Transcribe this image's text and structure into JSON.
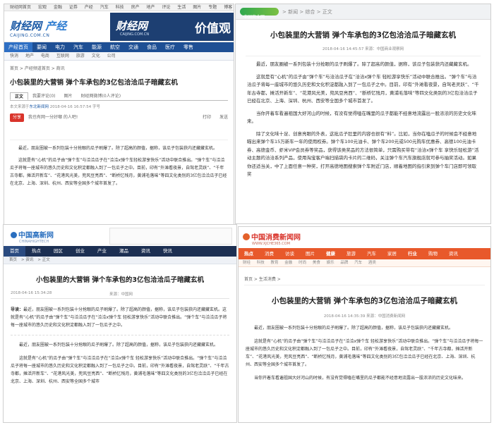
{
  "panel1": {
    "topbar_items": [
      "财经网首页",
      "宏观",
      "金融",
      "证券",
      "产经",
      "汽车",
      "科技",
      "房产",
      "地产",
      "评论",
      "生活",
      "图片",
      "专题",
      "博客",
      "视频"
    ],
    "logo_main": "财经网",
    "logo_sub": "产经",
    "logo_domain": "CAIJING.COM.CN",
    "banner_left": "财经网",
    "banner_domain": "CAIJING.COM.CN",
    "banner_right": "价值观",
    "nav_items": [
      "产经首页",
      "要闻",
      "电力",
      "汽车",
      "能源",
      "航空",
      "交通",
      "食品",
      "医疗",
      "零售"
    ],
    "subnav_items": [
      "快消",
      "地产",
      "电商",
      "互联网",
      "旅游",
      "文化",
      "公司"
    ],
    "breadcrumb": "首页 > 产经频道首页 > 商讯",
    "title": "小包装里的大营销 弹个车承包的3亿包洽洽瓜子暗藏玄机",
    "tabs": [
      "正文",
      "我要评论(0)",
      "图片",
      "财经网微博(0人评论)"
    ],
    "meta_prefix": "本文来源于",
    "meta_source": "东北新闻网",
    "meta_rest": "2018-04-16 16:57:54  字号",
    "share_button": "分享",
    "share_text": "我也有网一分好嘲 的人吧!",
    "tools": [
      "打印",
      "发送"
    ],
    "paragraphs": [
      "最近，朋友圈被一系列包装十分抢眼的瓜子刷爆了。除了超高的颜值，据称，该瓜子包装获内还藏藏玄机。",
      "这就是有“心机”的瓜子由“弹个车”与洽洽瓜子在“洽洽x弹个车轻松游享快乐”活动中联合推出。“弹个车”与洽洽瓜子将每一座城市的悠久历史和文化积淀都融入到了一包瓜子之中。目前，印有“外滩看夜景，自驾老灵跃”、“千年古寺都，摊活开新车”、“花港风光美，兜风豆亮西”、“断桥忆残月，黄浦毛落味”等四文化类别的3亿包洽洽瓜子已经在北京、上海、深圳、杭州、西安等全国多个城市首发了。"
    ]
  },
  "panel2": {
    "logo": "中国商业网",
    "breadcrumb": "> 新闻 > 综合 > 正文",
    "title": "小包装里的大营销 弹个车承包的3亿包洽洽瓜子暗藏玄机",
    "meta": "2018-04-16 14:45:57    来源：中国商业观察网",
    "paragraphs": [
      "最近，朋友圈被一系列包装十分抢眼的瓜子刷爆了。除了超高的颜值，据称，该瓜子包装获内还藏藏玄机。",
      "这就是有“心机”的瓜子由“弹个车”与洽洽瓜子在“洽洽x弹个车 轻松游享快乐”活动中联合推出。“弹个车”与洽洽瓜子将每一座城市的悠久历史和文化积淀都融入到了一包瓜子之中。目前，印有“外滩看夜景，自驾老灵跃”、“千年古寺都，摊活开新车”、“花港风光美，兜风豆亮西”、“断桥忆残月，黄浦毛落味”等四文化类别的3亿包洽洽瓜子已经在北京、上海、深圳、杭州、西安等全国多个城市首发了。",
      "当你开着车看遍祖国大好河山的时候，有没有觉得嗑在嘴里的瓜子都能不经意地流露出一股浓浓的历史文化味来。",
      "除了文化味十足、创意亮眼的外表，这批瓜子肚里的内容也很有“料”。比如，当你在嗑瓜子的时候会不经意地瞄出来弹个车15万新车一年的使用权券。弹个车100元油卡、弹个车200元或500元购车优惠券、高德100元油卡券、高德金币、虾米VIP会员券等奖品，获得该类奖品的方法很简单，只需购买带有“洽洽x弹个车 享快乐轻松游”活动主题的洽洽系列产品，使用淘宝客户端扫描袋内卡片的二维码，关注弹个车汽车旗舰店就可参与抽奖活动。如果你还适当关，中了上面任意一种奖，打开高德地图搜索弹个车附近门店，顺着地图的指引来到弹个车门店即可领取奖"
    ]
  },
  "panel3": {
    "logo_main": "中国高新网",
    "logo_sub": "CHINAHIGHTECH",
    "nav_items": [
      "首页",
      "热点",
      "园区",
      "创业",
      "产业",
      "潮品",
      "资讯",
      "快讯"
    ],
    "subnav_items": [
      "首页",
      "资讯",
      "正文"
    ],
    "title": "小包装里的大营销 弹个车承包的3亿包洽洽瓜子暗藏玄机",
    "meta_date": "2018-04-16 15:34:28",
    "meta_source": "来源：中国网",
    "digest_label": "导读：",
    "digest_text": "最近，朋友圈被一系列包装十分抢眼的瓜子刷爆了。除了超高的颜值，据称，该瓜子包装获内还藏藏玄机。这就是有“心机”的瓜子由“弹个车”与洽洽瓜子在“洽洽x弹个车 轻松游享快乐”活动中联合推出。“弹个车”与洽洽瓜子将每一座城市的悠久历史和文化积淀都融入到了一包瓜子之中。",
    "paragraphs": [
      "最近，朋友圈被一系列包装十分抢眼的瓜子刷爆了。除了超高的颜值，据称，该瓜子包装获内还藏藏玄机。",
      "这就是有“心机”的瓜子由“弹个车”与洽洽瓜子在“洽洽x弹个车 轻松游享快乐”活动中联合推出。“弹个车”与洽洽瓜子将每一座城市的悠久历史和文化积淀都融入到了一包瓜子之中。目前，印有“外滩看夜景，自驾老灵跃”、“千年古寺都，摊活开新车”、“花港风光美，兜风豆亮西”、“断桥忆残月，黄浦毛落味”等四文化类别的3亿包洽洽瓜子已经在北京、上海、深圳、杭州、西安等全国多个城市"
    ]
  },
  "panel4": {
    "logo_main": "中国消费新闻网",
    "logo_sub": "WWW.XJCHE365.COM",
    "nav_items": [
      "热点",
      "消费",
      "访谈",
      "图片",
      "健康",
      "旅游",
      "汽车",
      "家居",
      "行业",
      "购物",
      "资讯"
    ],
    "subnav_items": [
      "财经",
      "科技",
      "教育",
      "金融",
      "时尚",
      "美食",
      "娱乐",
      "品牌",
      "汽车",
      "酒类"
    ],
    "breadcrumb": "首页 > 生活消费 >",
    "title": "小包装里的大营销 弹个车承包的3亿包洽洽瓜子暗藏玄机",
    "meta": "2018-04-16 14:35:39    来源：中国消费新闻网",
    "paragraphs": [
      "最近，朋友圈被一系列包装十分抢眼的瓜子刷爆了。除了超高的颜值，据称，该瓜子包装获内还藏藏玄机。",
      "这就是有“心机”的瓜子由“弹个车”与洽洽瓜子在“洽洽x弹个车 轻松游享快乐”活动中联合推出。“弹个车”与洽洽瓜子将每一座城市的悠久历史和文化积淀都融入到了一包瓜子之中。目前，印有“外滩看夜景，自驾老灵跃”、“千年古寺都，摊活开新车”、“花港风光美，兜风豆亮西”、“断桥忆残月，黄浦毛落味”等四文化类别的3亿包洽洽瓜子已经在北京、上海、深圳、杭州、西安等全国多个城市首发了。",
      "当你开着车看遍祖国大好河山的时候，有没有觉得嗑在嘴里的瓜子都能不经意地流露出一股浓浓的历史文化味来。"
    ]
  }
}
